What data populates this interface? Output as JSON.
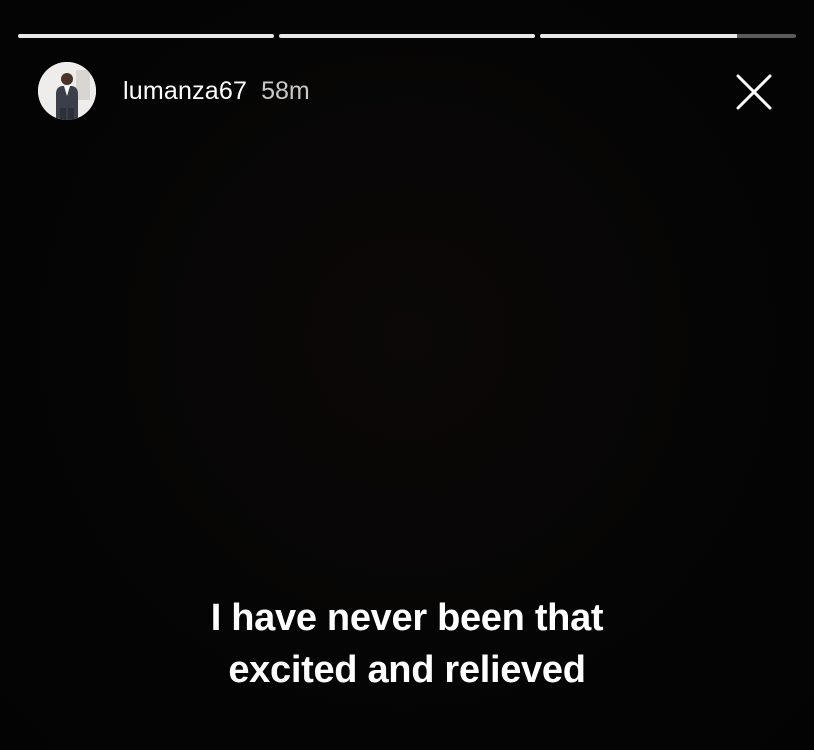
{
  "story": {
    "progress_segments": [
      1.0,
      1.0,
      0.77
    ],
    "username": "lumanza67",
    "time_ago": "58m",
    "caption_lines": [
      "I have never been that",
      "excited and relieved"
    ]
  },
  "icons": {
    "avatar": "profile-photo",
    "close": "close-icon"
  },
  "colors": {
    "background": "#050505",
    "text": "#ffffff",
    "progress_filled": "#e8e8e8",
    "progress_track": "rgba(255,255,255,0.35)"
  }
}
